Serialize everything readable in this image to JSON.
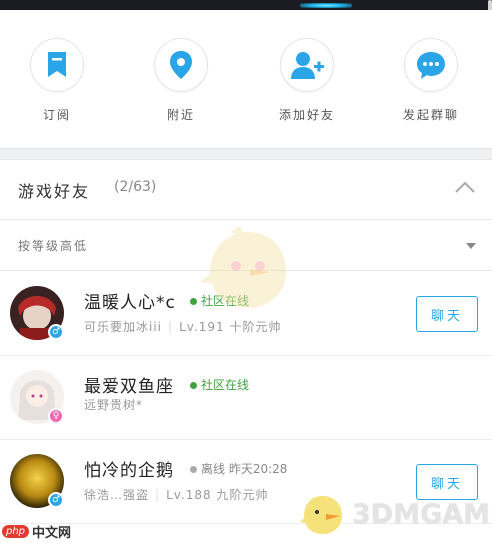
{
  "quick_actions": [
    {
      "label": "订阅",
      "icon": "bookmark-icon"
    },
    {
      "label": "附近",
      "icon": "location-pin-icon"
    },
    {
      "label": "添加好友",
      "icon": "add-friend-icon"
    },
    {
      "label": "发起群聊",
      "icon": "group-chat-icon"
    }
  ],
  "section": {
    "title": "游戏好友",
    "count": "(2/63)"
  },
  "sort": {
    "label": "按等级高低"
  },
  "friends": [
    {
      "name": "温暖人心*c",
      "status": "社区在线",
      "status_type": "online",
      "sub_a": "可乐要加冰iii",
      "sub_b": "Lv.191  十阶元帅",
      "gender": "male",
      "chat_label": "聊天"
    },
    {
      "name": "最爱双鱼座",
      "status": "社区在线",
      "status_type": "online",
      "sub_a": "远野贵树*",
      "sub_b": "",
      "gender": "female",
      "chat_label": ""
    },
    {
      "name": "怕冷的企鹅",
      "status": "离线 昨天20:28",
      "status_type": "offline",
      "sub_a": "徐浩…强盗",
      "sub_b": "Lv.188  九阶元帅",
      "gender": "male",
      "chat_label": "聊天"
    }
  ],
  "watermark": {
    "text": "3DMGAME"
  },
  "corner_logo": {
    "badge": "php",
    "text": "中文网"
  },
  "colors": {
    "accent": "#2aa6e8",
    "online": "#3fa33f",
    "female": "#f06ab0"
  }
}
